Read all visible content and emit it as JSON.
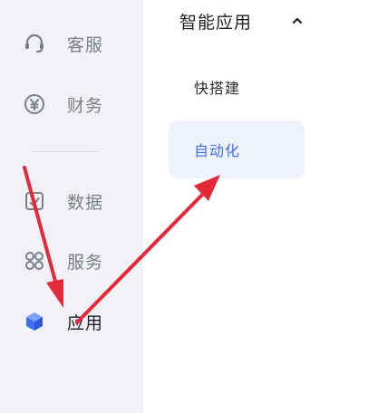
{
  "sidebar": {
    "items": [
      {
        "label": "客服",
        "icon": "headset-icon"
      },
      {
        "label": "财务",
        "icon": "yuan-circle-icon"
      },
      {
        "label": "数据",
        "icon": "chart-box-icon"
      },
      {
        "label": "服务",
        "icon": "grid-circles-icon"
      },
      {
        "label": "应用",
        "icon": "cube-icon"
      }
    ]
  },
  "panel": {
    "title": "智能应用",
    "items": [
      {
        "label": "快搭建"
      },
      {
        "label": "自动化"
      }
    ]
  },
  "colors": {
    "accent": "#3d6ff0",
    "annotation_arrow": "#e5283a",
    "sidebar_bg": "#f1f2f7"
  }
}
